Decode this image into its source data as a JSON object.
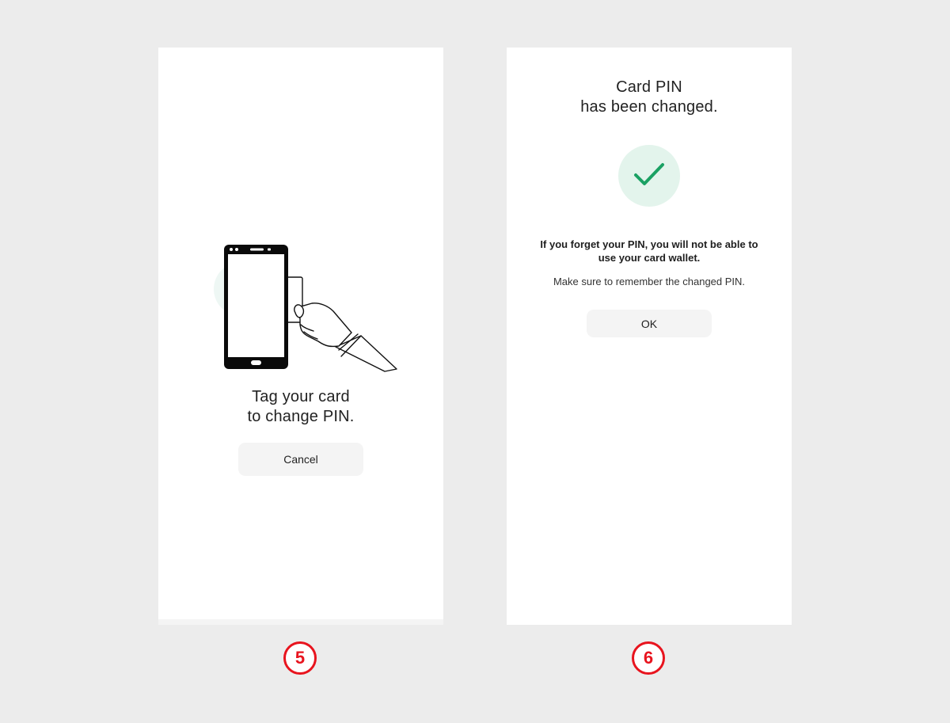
{
  "screen5": {
    "title_lines": [
      "Tag your card",
      "to change PIN."
    ],
    "cancel_label": "Cancel",
    "step_number": "5"
  },
  "screen6": {
    "title_lines": [
      "Card PIN",
      "has been changed."
    ],
    "warning_lines": [
      "If you forget your PIN, you will not be able to",
      "use your card wallet."
    ],
    "note": "Make sure to remember the changed PIN.",
    "ok_label": "OK",
    "step_number": "6"
  },
  "icons": {
    "illustration": "phone-card-tag-illustration",
    "success": "check-icon"
  },
  "colors": {
    "badge": "#e8141e",
    "success_check": "#1aa163",
    "success_bg": "#e3f4ec",
    "button_bg": "#f4f4f4",
    "background": "#ececec"
  }
}
